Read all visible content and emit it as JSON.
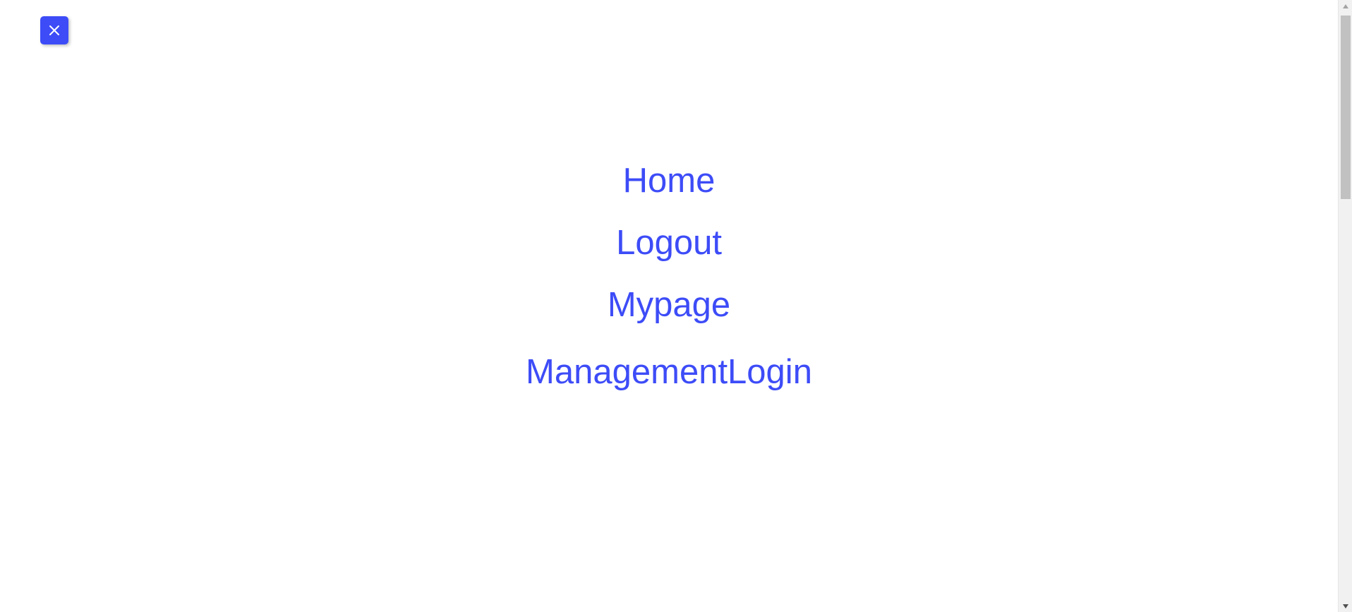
{
  "close_button": {
    "icon": "close-icon",
    "color": "#3d4cf7"
  },
  "menu": {
    "items": [
      {
        "label": "Home"
      },
      {
        "label": "Logout"
      },
      {
        "label": "Mypage"
      },
      {
        "label": "ManagementLogin"
      }
    ],
    "link_color": "#3d4cf7"
  },
  "scrollbar": {
    "up_icon": "triangle-up-icon",
    "down_icon": "triangle-down-icon"
  }
}
